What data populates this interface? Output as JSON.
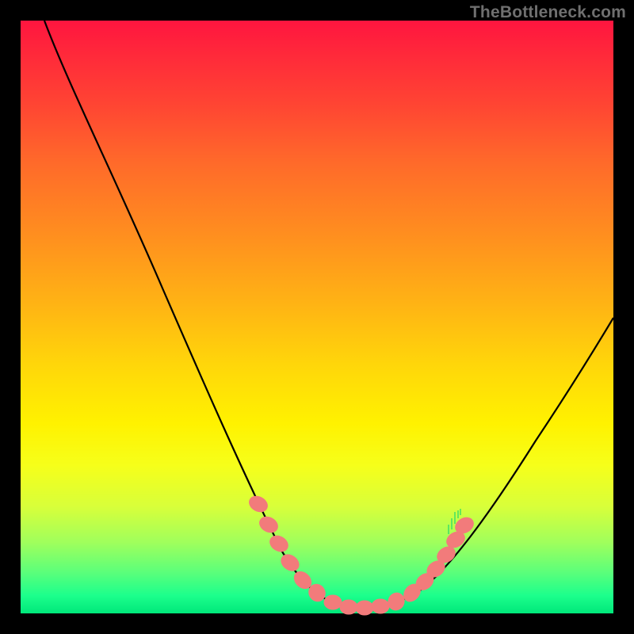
{
  "watermark": "TheBottleneck.com",
  "chart_data": {
    "type": "line",
    "title": "",
    "xlabel": "",
    "ylabel": "",
    "xlim": [
      0,
      100
    ],
    "ylim": [
      0,
      100
    ],
    "grid": false,
    "series": [
      {
        "name": "bottleneck-curve",
        "points": [
          {
            "x": 4,
            "y": 100
          },
          {
            "x": 12,
            "y": 86
          },
          {
            "x": 20,
            "y": 70
          },
          {
            "x": 28,
            "y": 52
          },
          {
            "x": 34,
            "y": 38
          },
          {
            "x": 40,
            "y": 24
          },
          {
            "x": 44,
            "y": 14
          },
          {
            "x": 48,
            "y": 6
          },
          {
            "x": 52,
            "y": 2
          },
          {
            "x": 56,
            "y": 1
          },
          {
            "x": 60,
            "y": 1
          },
          {
            "x": 64,
            "y": 2
          },
          {
            "x": 68,
            "y": 5
          },
          {
            "x": 74,
            "y": 13
          },
          {
            "x": 80,
            "y": 22
          },
          {
            "x": 88,
            "y": 34
          },
          {
            "x": 96,
            "y": 46
          },
          {
            "x": 100,
            "y": 52
          }
        ]
      }
    ],
    "highlight_dots": {
      "name": "highlighted-range",
      "color": "#f27878",
      "points": [
        {
          "x": 40,
          "y": 24
        },
        {
          "x": 42,
          "y": 19
        },
        {
          "x": 44,
          "y": 14
        },
        {
          "x": 46,
          "y": 10
        },
        {
          "x": 48,
          "y": 6
        },
        {
          "x": 50,
          "y": 3.5
        },
        {
          "x": 52,
          "y": 2
        },
        {
          "x": 54,
          "y": 1.3
        },
        {
          "x": 56,
          "y": 1
        },
        {
          "x": 58,
          "y": 1
        },
        {
          "x": 60,
          "y": 1
        },
        {
          "x": 62,
          "y": 1.4
        },
        {
          "x": 64,
          "y": 2
        },
        {
          "x": 66,
          "y": 3.2
        },
        {
          "x": 68,
          "y": 5
        },
        {
          "x": 70,
          "y": 8
        },
        {
          "x": 72,
          "y": 11
        },
        {
          "x": 74,
          "y": 15
        }
      ]
    }
  }
}
